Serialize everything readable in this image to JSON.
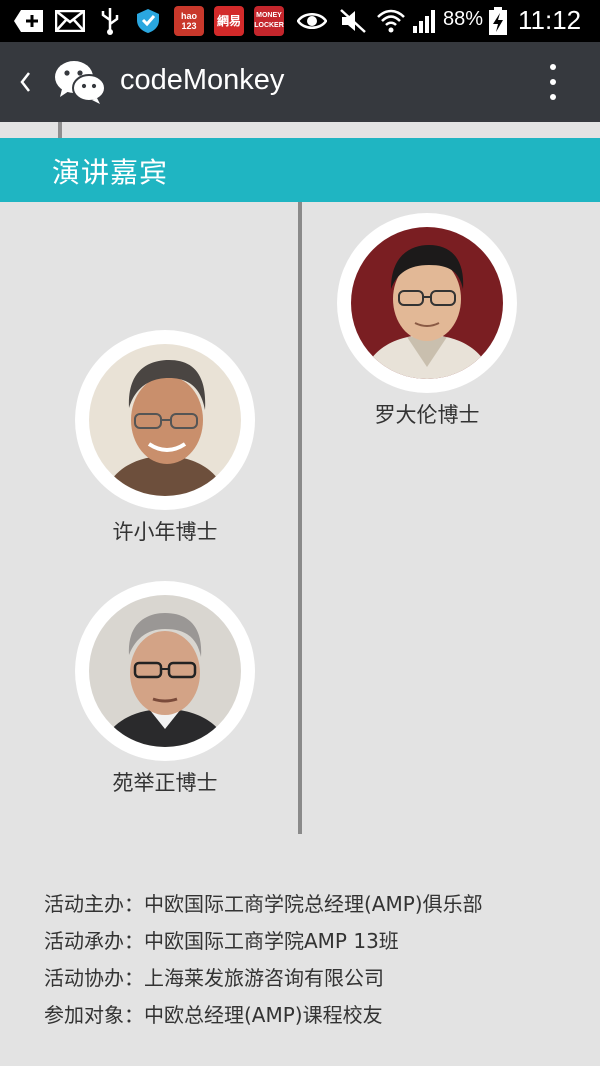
{
  "status_bar": {
    "battery_percent": "88%",
    "time": "11:12",
    "app_badges": [
      {
        "name": "hao123",
        "text": "hao 123",
        "color": "#c9382b"
      },
      {
        "name": "netease",
        "text": "網易",
        "color": "#d32a2a"
      },
      {
        "name": "money-locker",
        "text": "MONEY LOCKER",
        "color": "#c4262c"
      }
    ]
  },
  "action_bar": {
    "title": "codeMonkey",
    "back_icon": "back-chevron-icon",
    "logo_icon": "wechat-logo-icon",
    "menu_icon": "overflow-menu-icon"
  },
  "section": {
    "title": "演讲嘉宾",
    "accent_color": "#1fb5c2"
  },
  "speakers": [
    {
      "name": "罗大伦博士",
      "side": "right",
      "portrait_bg": "#7a1e22"
    },
    {
      "name": "许小年博士",
      "side": "left",
      "portrait_bg": "#e9e2d6"
    },
    {
      "name": "苑举正博士",
      "side": "left",
      "portrait_bg": "#d9d6d0"
    }
  ],
  "info": [
    "活动主办：中欧国际工商学院总经理(AMP)俱乐部",
    "活动承办：中欧国际工商学院AMP 13班",
    "活动协办：上海莱发旅游咨询有限公司",
    "参加对象：中欧总经理(AMP)课程校友"
  ]
}
